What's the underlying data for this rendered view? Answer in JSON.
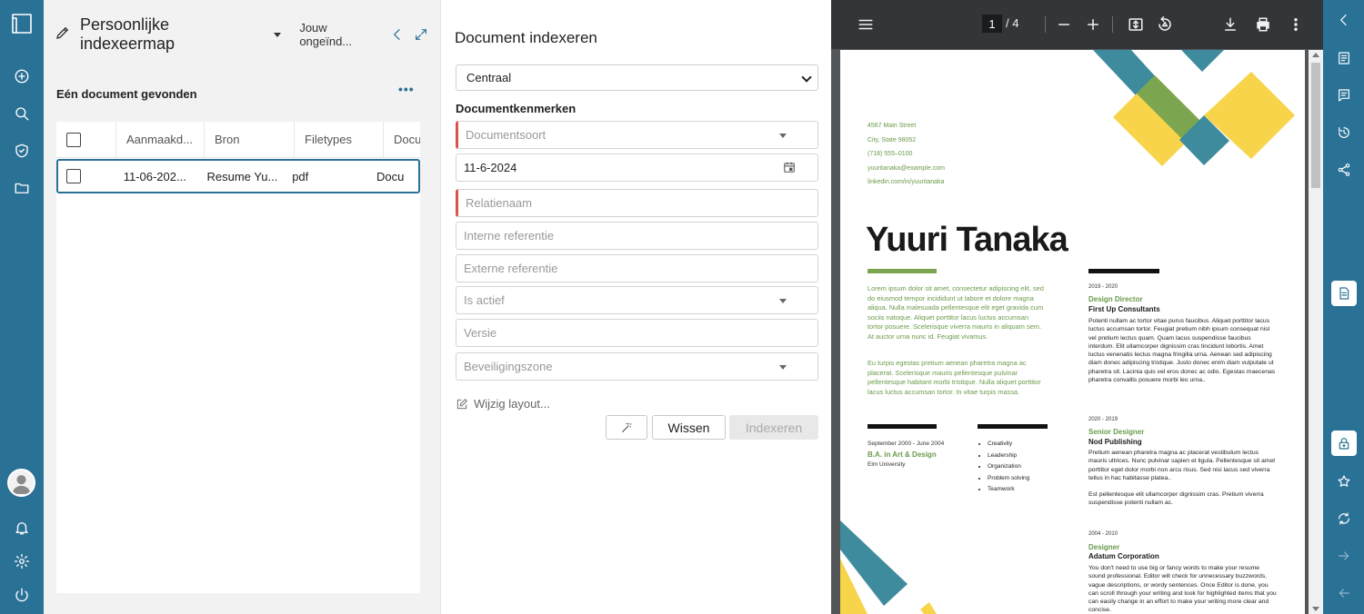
{
  "folder": {
    "title": "Persoonlijke indexeermap",
    "subtitle": "Jouw ongeïnd...",
    "found_text": "Eén document gevonden",
    "more_label": "•••",
    "columns": [
      "Aanmaakd...",
      "Bron",
      "Filetypes",
      "Docu"
    ],
    "rows": [
      {
        "date": "11-06-202...",
        "source": "Resume Yu...",
        "filetype": "pdf",
        "doc": "Docu"
      }
    ]
  },
  "form": {
    "title": "Document indexeren",
    "zone_select": "Centraal",
    "section_title": "Documentkenmerken",
    "documentsoort": "Documentsoort",
    "date_value": "11-6-2024",
    "relatienaam": "Relatienaam",
    "interne_referentie": "Interne referentie",
    "externe_referentie": "Externe referentie",
    "is_actief": "Is actief",
    "versie": "Versie",
    "beveiligingszone": "Beveiligingszone",
    "layout_link": "Wijzig layout...",
    "clear_label": "Wissen",
    "index_label": "Indexeren"
  },
  "viewer": {
    "page_current": "1",
    "page_total": "/   4"
  },
  "resume": {
    "contact": [
      "4567 Main Street",
      "City, State 98052",
      "(718) 555–0100",
      "yuuritanaka@example.com",
      "linkedin.com/in/yuuritanaka"
    ],
    "name": "Yuuri Tanaka",
    "intro_1": "Lorem ipsum dolor sit amet, consectetur adipiscing elit, sed do eiusmod tempor incididunt ut labore et dolore magna aliqua. Nulla malesuada pellentesque elit eget gravida cum sociis natoque. Aliquet porttitor lacus luctus accumsan tortor posuere. Scelerisque viverra mauris in aliquam sem. At auctor urna nunc id. Feugiat vivamus.",
    "intro_2": "Eu turpis egestas pretium aenean pharetra magna ac placerat. Scelerisque mauris pellentesque pulvinar pellentesque habitant morbi tristique. Nulla aliquet porttitor lacus luctus accumsan tortor. In vitae turpis massa.",
    "jobs": [
      {
        "date": "2019 - 2020",
        "title": "Design Director",
        "company": "First Up Consultants",
        "desc": "Potenti nullam ac tortor vitae purus faucibus. Aliquet porttitor lacus luctus accumsan tortor. Feugiat pretium nibh ipsum consequat nisl vel pretium lectus quam. Quam lacus suspendisse faucibus interdum. Elit ullamcorper dignissim cras tincidunt lobortis. Amet luctus venenatis lectus magna fringilla urna. Aenean sed adipiscing diam donec adipiscing tristique. Justo donec enim diam vulputate ut pharetra sit. Lacinia quis vel eros donec ac odio. Egestas maecenas pharetra convallis posuere morbi leo urna.."
      },
      {
        "date": "2020 - 2019",
        "title": "Senior Designer",
        "company": "Nod Publishing",
        "desc": "Pretium aenean pharetra magna ac placerat vestibulum lectus mauris ultrices. Nunc pulvinar sapien et ligula. Pellentesque sit amet porttitor eget dolor morbi non arcu risus. Sed nisi lacus sed viverra tellus in hac habitasse platea..",
        "desc_2": "Est pellentesque elit ullamcorper dignissim cras. Pretium viverra suspendisse potenti nullam ac."
      },
      {
        "date": "2004 - 2010",
        "title": "Designer",
        "company": "Adatum Corporation",
        "desc": "You don't need to use big or fancy words to make your resume sound professional. Editor will check for unnecessary buzzwords, vague descriptions, or wordy sentences. Once Editor is done, you can scroll through your writing and look for highlighted items that you can easily change in an effort to make your writing more clear and concise."
      }
    ],
    "education": {
      "date": "September 2000 - June 2004",
      "degree": "B.A. in Art & Design",
      "school": "Elm University"
    },
    "skills": [
      "Creativity",
      "Leadership",
      "Organization",
      "Problem solving",
      "Teamwork"
    ]
  },
  "colors": {
    "rail": "#2a7196",
    "resume_green": "#6a9b4a",
    "teal": "#3f8b9e",
    "yellow": "#f7d44a",
    "olive": "#7ba64f",
    "required": "#d9534f"
  }
}
